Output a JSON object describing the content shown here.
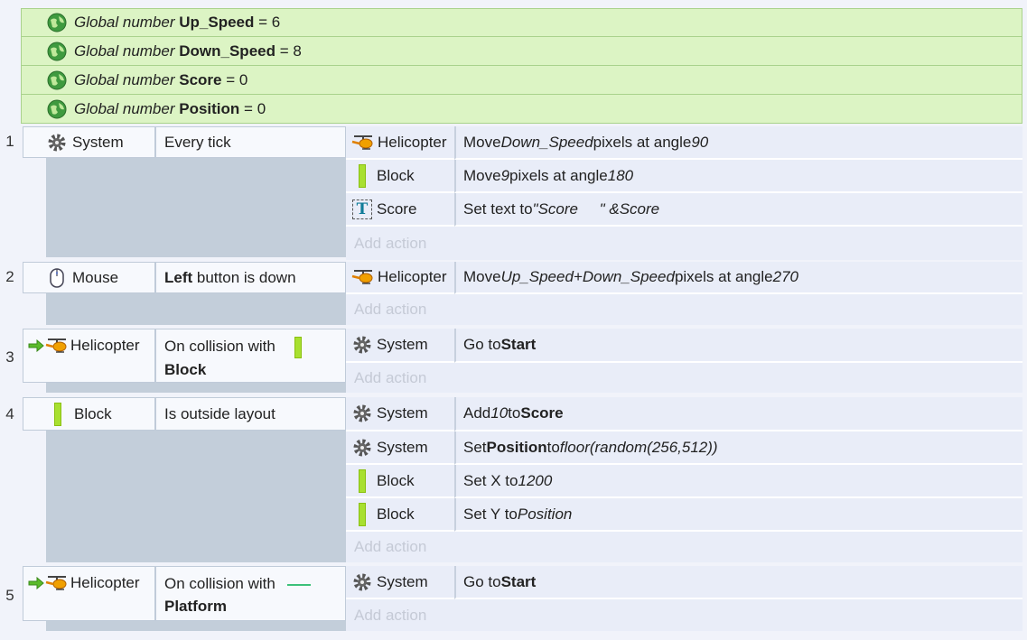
{
  "globals": [
    {
      "kind": "Global number",
      "name": "Up_Speed",
      "eq": "=",
      "value": "6"
    },
    {
      "kind": "Global number",
      "name": "Down_Speed",
      "eq": "=",
      "value": "8"
    },
    {
      "kind": "Global number",
      "name": "Score",
      "eq": "=",
      "value": "0"
    },
    {
      "kind": "Global number",
      "name": "Position",
      "eq": "=",
      "value": "0"
    }
  ],
  "add_action_label": "Add action",
  "events": [
    {
      "number": "1",
      "condition": {
        "object": "System",
        "text": "Every tick"
      },
      "actions": [
        {
          "object": "Helicopter",
          "p1": "Move ",
          "i1": "Down_Speed",
          "p2": " pixels at angle ",
          "i2": "90"
        },
        {
          "object": "Block",
          "p1": "Move ",
          "i1": "9",
          "p2": " pixels at angle ",
          "i2": "180"
        },
        {
          "object": "Score",
          "p1": "Set text to ",
          "i1": "\"Score     \" &Score"
        }
      ]
    },
    {
      "number": "2",
      "condition": {
        "object": "Mouse",
        "bold": "Left",
        "text": " button is down"
      },
      "actions": [
        {
          "object": "Helicopter",
          "p1": "Move ",
          "i1": "Up_Speed+Down_Speed",
          "p2": " pixels at angle ",
          "i2": "270"
        }
      ]
    },
    {
      "number": "3",
      "condition": {
        "object": "Helicopter",
        "text": "On collision with",
        "target": "Block"
      },
      "actions": [
        {
          "object": "System",
          "p1": "Go to ",
          "b1": "Start"
        }
      ]
    },
    {
      "number": "4",
      "condition": {
        "object": "Block",
        "text": "Is outside layout"
      },
      "actions": [
        {
          "object": "System",
          "p1": "Add ",
          "i1": "10",
          "p2": " to ",
          "b1": "Score"
        },
        {
          "object": "System",
          "p1": "Set ",
          "b1": "Position",
          "p2": " to ",
          "i1": "floor(random(256,512))"
        },
        {
          "object": "Block",
          "p1": "Set X to ",
          "i1": "1200"
        },
        {
          "object": "Block",
          "p1": "Set Y to ",
          "i1": "Position"
        }
      ]
    },
    {
      "number": "5",
      "condition": {
        "object": "Helicopter",
        "text": "On collision with",
        "target": "Platform"
      },
      "actions": [
        {
          "object": "System",
          "p1": "Go to ",
          "b1": "Start"
        }
      ]
    }
  ],
  "colors": {
    "global_bg": "#dcf4c4",
    "event_bar": "#c3ceda",
    "action_bg": "#e9edf8",
    "block_green": "#a8e030"
  }
}
